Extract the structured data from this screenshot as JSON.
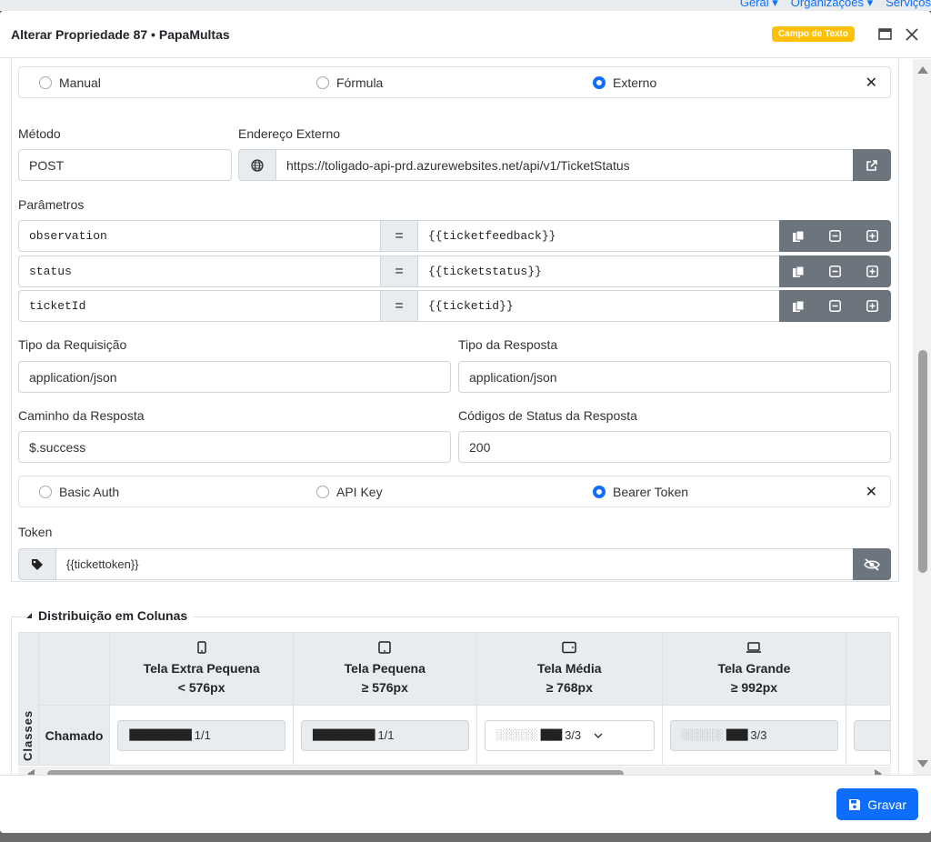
{
  "bg_nav": {
    "links": [
      "Geral ▾",
      "Organizações ▾",
      "Serviços"
    ]
  },
  "header": {
    "title": "Alterar Propriedade 87 • PapaMultas",
    "badge": "Campo de Texto"
  },
  "source_options": {
    "manual": "Manual",
    "formula": "Fórmula",
    "externo": "Externo",
    "selected": "Externo"
  },
  "method": {
    "label": "Método",
    "value": "POST"
  },
  "external_address": {
    "label": "Endereço Externo",
    "value": "https://toligado-api-prd.azurewebsites.net/api/v1/TicketStatus"
  },
  "params": {
    "label": "Parâmetros",
    "items": [
      {
        "key": "observation",
        "value": "{{ticketfeedback}}"
      },
      {
        "key": "status",
        "value": "{{ticketstatus}}"
      },
      {
        "key": "ticketId",
        "value": "{{ticketid}}"
      }
    ],
    "eq": "="
  },
  "request_type": {
    "label": "Tipo da Requisição",
    "value": "application/json"
  },
  "response_type": {
    "label": "Tipo da Resposta",
    "value": "application/json"
  },
  "response_path": {
    "label": "Caminho da Resposta",
    "value": "$.success"
  },
  "status_codes": {
    "label": "Códigos de Status da Resposta",
    "value": "200"
  },
  "auth_options": {
    "basic": "Basic Auth",
    "apikey": "API Key",
    "bearer": "Bearer Token",
    "selected": "Bearer Token"
  },
  "token": {
    "label": "Token",
    "value": "{{tickettoken}}"
  },
  "columns_section": {
    "title": "Distribuição em Colunas",
    "side_label": "Classes",
    "headers": [
      {
        "name": "Tela Extra Pequena",
        "size": "< 576px"
      },
      {
        "name": "Tela Pequena",
        "size": "≥ 576px"
      },
      {
        "name": "Tela Média",
        "size": "≥ 768px"
      },
      {
        "name": "Tela Grande",
        "size": "≥ 992px"
      }
    ],
    "row_label": "Chamado",
    "cells": [
      {
        "blocks": "████████████",
        "value": "1/1"
      },
      {
        "blocks": "████████████",
        "value": "1/1"
      },
      {
        "dots": "░░░░░░░░",
        "blocks": "████",
        "value": "3/3"
      },
      {
        "dots": "░░░░░░░░",
        "blocks": "████",
        "value": "3/3"
      }
    ]
  },
  "footer": {
    "save_label": "Gravar"
  },
  "colors": {
    "primary": "#0d6efd",
    "badge": "#ffc107",
    "secondary": "#6c757d"
  }
}
